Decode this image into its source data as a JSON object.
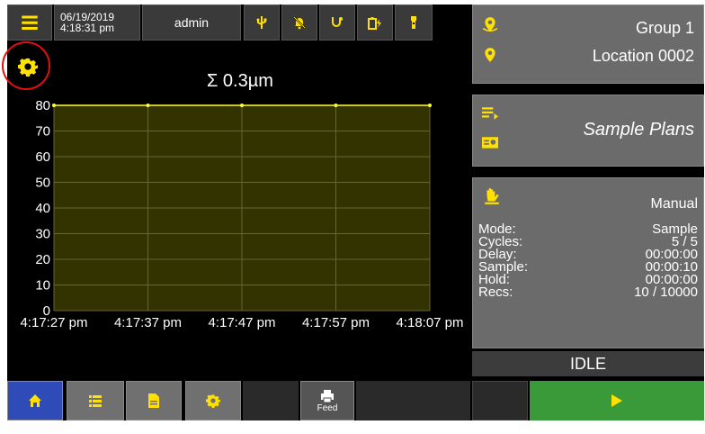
{
  "topbar": {
    "date": "06/19/2019",
    "time": "4:18:31 pm",
    "user": "admin",
    "icons": [
      "menu-icon",
      "usb-icon",
      "alarm-off-icon",
      "probe-icon",
      "battery-charging-icon",
      "flashlight-icon"
    ]
  },
  "chart_data": {
    "type": "area",
    "title": "Σ 0.3µm",
    "x": [
      "4:17:27 pm",
      "4:17:37 pm",
      "4:17:47 pm",
      "4:17:57 pm",
      "4:18:07 pm"
    ],
    "series": [
      {
        "values": [
          80,
          80,
          80,
          80,
          80
        ]
      }
    ],
    "yticks": [
      "0",
      "10",
      "20",
      "30",
      "40",
      "50",
      "60",
      "70",
      "80"
    ],
    "ylim": [
      0,
      80
    ],
    "grid": true,
    "colors": {
      "line": "#ffff33",
      "fill": "#333300",
      "grid": "#666633"
    }
  },
  "location": {
    "group": "Group 1",
    "location": "Location 0002"
  },
  "sample_plans": {
    "label": "Sample Plans"
  },
  "mode_panel": {
    "mode_title": "Manual",
    "rows": [
      {
        "label": "Mode:",
        "value": "Sample"
      },
      {
        "label": "Cycles:",
        "value": "5 / 5"
      },
      {
        "label": "Delay:",
        "value": "00:00:00"
      },
      {
        "label": "Sample:",
        "value": "00:00:10"
      },
      {
        "label": "Hold:",
        "value": "00:00:00"
      },
      {
        "label": "Recs:",
        "value": "10 / 10000"
      }
    ]
  },
  "status": "IDLE",
  "bottom": {
    "feed_label": "Feed",
    "play_color": "#3a9a3a"
  },
  "colors": {
    "accent_yellow": "#ffe000",
    "active_nav": "#2e4bb8"
  }
}
